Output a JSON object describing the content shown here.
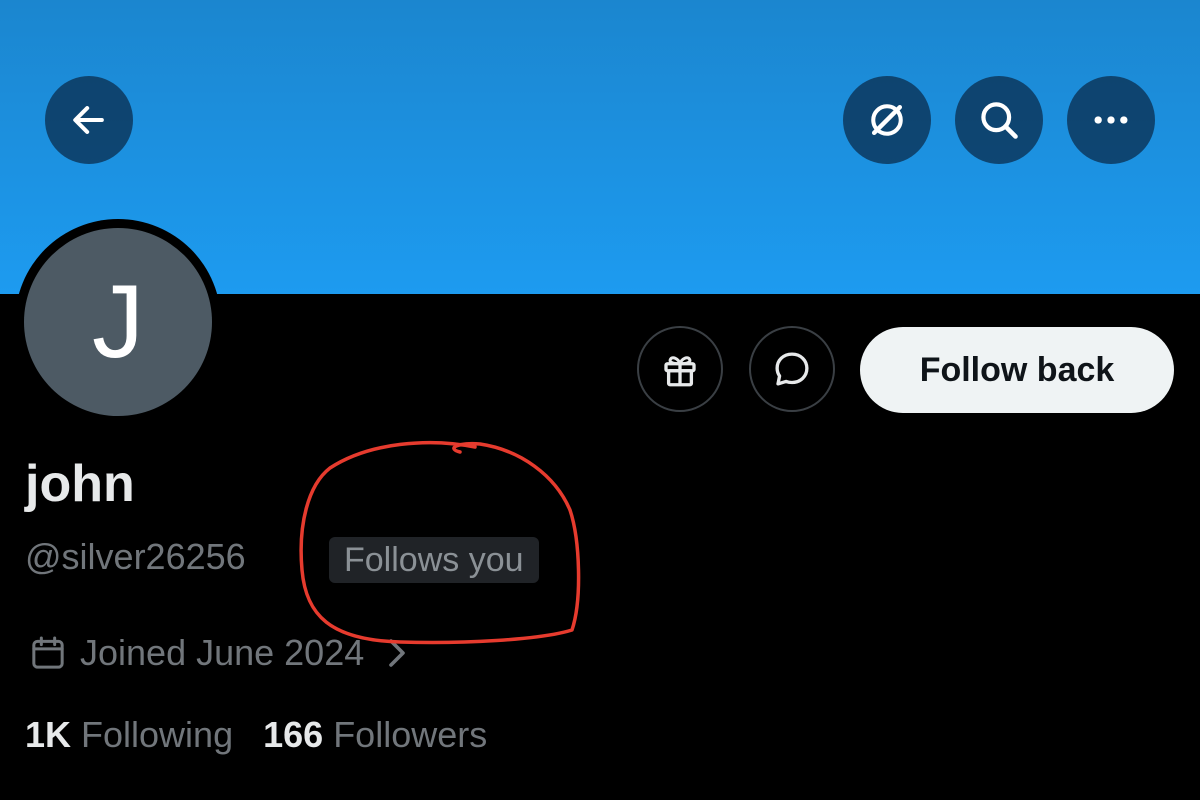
{
  "header": {
    "back_icon": "arrow-left-icon",
    "grok_icon": "grok-icon",
    "search_icon": "search-icon",
    "more_icon": "more-horizontal-icon",
    "banner_color": "#1d9bf0"
  },
  "profile": {
    "avatar_initial": "J",
    "avatar_color": "#4d5a64",
    "display_name": "john",
    "handle": "@silver26256",
    "follows_you_badge": "Follows you",
    "joined": "Joined June 2024",
    "following_count": "1K",
    "following_label": "Following",
    "followers_count": "166",
    "followers_label": "Followers"
  },
  "actions": {
    "gift_icon": "gift-icon",
    "message_icon": "message-bubble-icon",
    "follow_back_label": "Follow back"
  },
  "annotation": {
    "color": "#e63b2e",
    "shape": "hand-drawn circle around Follows you badge"
  }
}
